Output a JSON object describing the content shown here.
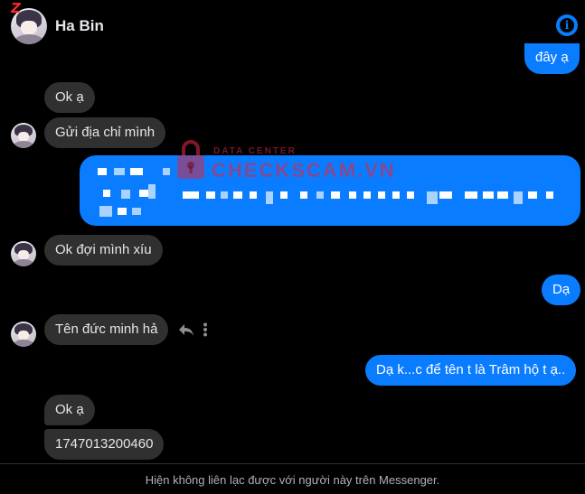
{
  "header": {
    "contact_name": "Ha Bin",
    "badge_letter": "Z",
    "info_glyph": "i"
  },
  "watermark": {
    "top_line": "DATA CENTER",
    "main_line": "CHECKSCAM.VN"
  },
  "messages": [
    {
      "direction": "outgoing",
      "text": "đây ạ"
    },
    {
      "direction": "incoming",
      "text": "Ok ạ"
    },
    {
      "direction": "incoming",
      "text": "Gửi địa chỉ mình"
    },
    {
      "direction": "outgoing",
      "text": "",
      "redacted": true
    },
    {
      "direction": "incoming",
      "text": "Ok đợi mình xíu"
    },
    {
      "direction": "outgoing",
      "text": "Dạ"
    },
    {
      "direction": "incoming",
      "text": "Tên đức minh hả"
    },
    {
      "direction": "outgoing",
      "text": "Dạ k...c để tên t là Trâm hộ t ạ.."
    },
    {
      "direction": "incoming",
      "text": "Ok ạ"
    },
    {
      "direction": "incoming",
      "text": "1747013200460"
    }
  ],
  "footer": {
    "notice": "Hiện không liên lạc được với người này trên Messenger."
  },
  "icons": [
    "info-icon",
    "reply-icon",
    "more-vertical-icon",
    "lock-icon",
    "avatar"
  ],
  "colors": {
    "background": "#000000",
    "outgoing_bubble": "#0a7cff",
    "incoming_bubble": "#303030",
    "text": "#e4e6eb",
    "muted": "#b0b3b8",
    "watermark": "#d62846"
  }
}
